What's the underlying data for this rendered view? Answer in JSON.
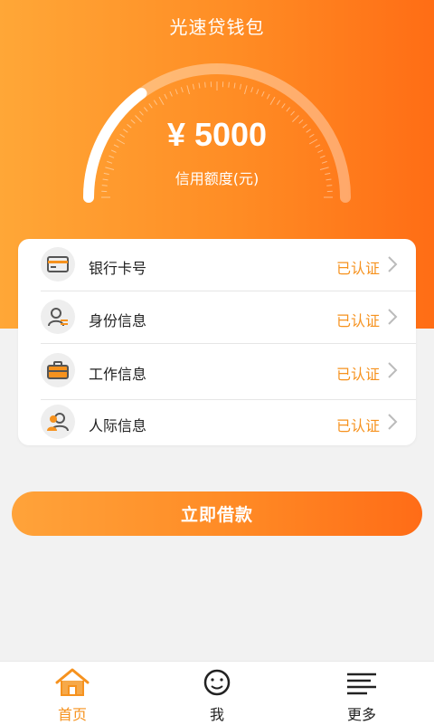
{
  "app": {
    "title": "光速贷钱包"
  },
  "credit": {
    "amount": "¥ 5000",
    "label": "信用额度(元)",
    "gauge_fill_fraction": 0.3
  },
  "verification_items": [
    {
      "label": "银行卡号",
      "status": "已认证",
      "icon": "bank-card-icon"
    },
    {
      "label": "身份信息",
      "status": "已认证",
      "icon": "identity-icon"
    },
    {
      "label": "工作信息",
      "status": "已认证",
      "icon": "briefcase-icon"
    },
    {
      "label": "人际信息",
      "status": "已认证",
      "icon": "contacts-icon"
    }
  ],
  "cta": {
    "label": "立即借款"
  },
  "tabbar": {
    "tabs": [
      {
        "label": "首页",
        "icon": "home-icon",
        "active": true
      },
      {
        "label": "我",
        "icon": "profile-icon",
        "active": false
      },
      {
        "label": "更多",
        "icon": "menu-icon",
        "active": false
      }
    ]
  },
  "colors": {
    "accent": "#f6921e",
    "gradient_start": "#ffa737",
    "gradient_end": "#ff6d15",
    "background": "#f2f2f2"
  }
}
